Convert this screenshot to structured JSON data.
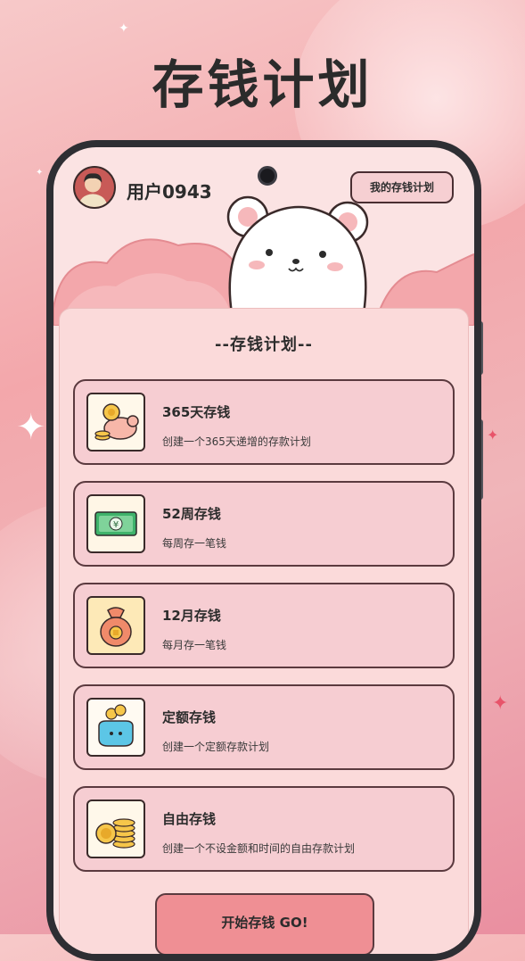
{
  "headline": "存钱计划",
  "user": {
    "name": "用户0943"
  },
  "header": {
    "my_plan_label": "我的存钱计划"
  },
  "panel": {
    "title": "--存钱计划--"
  },
  "plans": [
    {
      "title": "365天存钱",
      "desc": "创建一个365天递增的存款计划",
      "icon": "piggy-bank-coins-icon"
    },
    {
      "title": "52周存钱",
      "desc": "每周存一笔钱",
      "icon": "banknote-yuan-icon"
    },
    {
      "title": "12月存钱",
      "desc": "每月存一笔钱",
      "icon": "money-bag-icon"
    },
    {
      "title": "定额存钱",
      "desc": "创建一个定额存款计划",
      "icon": "coin-purse-icon"
    },
    {
      "title": "自由存钱",
      "desc": "创建一个不设金额和时间的自由存款计划",
      "icon": "coin-stack-icon"
    }
  ],
  "start_button": {
    "label": "开始存钱 GO!"
  },
  "colors": {
    "accent": "#ef8f94",
    "card_bg": "#f6cdd2",
    "outline": "#5b3a3f"
  }
}
